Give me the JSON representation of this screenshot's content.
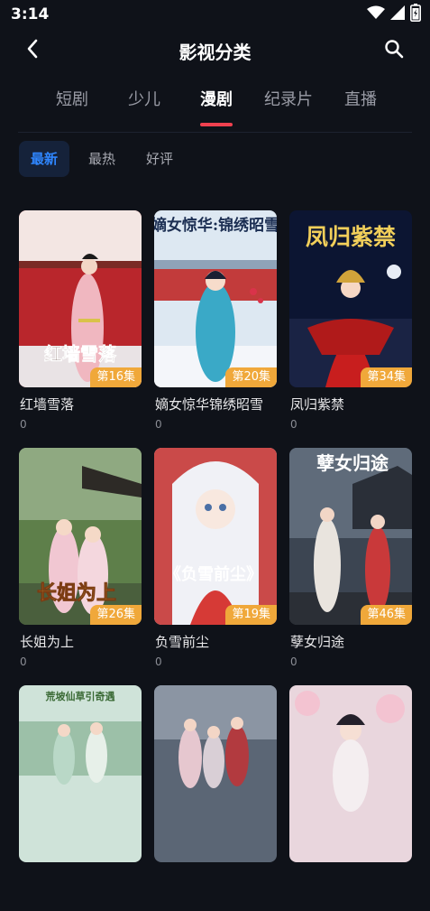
{
  "status": {
    "time": "3:14"
  },
  "header": {
    "title": "影视分类"
  },
  "category_tabs": [
    {
      "label": "短剧",
      "active": false
    },
    {
      "label": "少儿",
      "active": false
    },
    {
      "label": "漫剧",
      "active": true
    },
    {
      "label": "纪录片",
      "active": false
    },
    {
      "label": "直播",
      "active": false
    }
  ],
  "sort_tabs": [
    {
      "label": "最新",
      "active": true
    },
    {
      "label": "最热",
      "active": false
    },
    {
      "label": "好评",
      "active": false
    }
  ],
  "cards": [
    {
      "title": "红墙雪落",
      "episodes": "第16集",
      "count": "0",
      "poster_text": "红墙雪落"
    },
    {
      "title": "嫡女惊华锦绣昭雪",
      "episodes": "第20集",
      "count": "0",
      "poster_text": "嫡女惊华:锦绣昭雪"
    },
    {
      "title": "凤归紫禁",
      "episodes": "第34集",
      "count": "0",
      "poster_text": "凤归紫禁"
    },
    {
      "title": "长姐为上",
      "episodes": "第26集",
      "count": "0",
      "poster_text": "长姐为上"
    },
    {
      "title": "负雪前尘",
      "episodes": "第19集",
      "count": "0",
      "poster_text": "《负雪前尘》"
    },
    {
      "title": "孽女归途",
      "episodes": "第46集",
      "count": "0",
      "poster_text": "孽女归途"
    },
    {
      "title": "",
      "episodes": "",
      "count": "",
      "poster_text": "荒坡仙草引奇遇"
    },
    {
      "title": "",
      "episodes": "",
      "count": "",
      "poster_text": ""
    },
    {
      "title": "",
      "episodes": "",
      "count": "",
      "poster_text": ""
    }
  ],
  "colors": {
    "background": "#0f1219",
    "accent_underline": "#f0414f",
    "sort_active": "#2f86ff",
    "episode_badge": "#f0a83a"
  },
  "icons": {
    "back": "back-arrow-icon",
    "search": "search-icon",
    "wifi": "wifi-icon",
    "signal": "signal-icon",
    "battery": "battery-icon"
  }
}
